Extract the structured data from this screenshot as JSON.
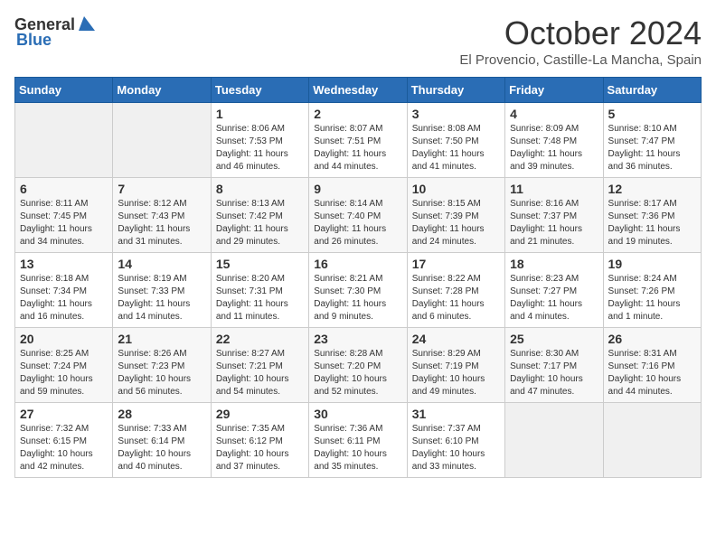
{
  "header": {
    "logo_general": "General",
    "logo_blue": "Blue",
    "month_title": "October 2024",
    "location": "El Provencio, Castille-La Mancha, Spain"
  },
  "weekdays": [
    "Sunday",
    "Monday",
    "Tuesday",
    "Wednesday",
    "Thursday",
    "Friday",
    "Saturday"
  ],
  "weeks": [
    [
      {
        "day": "",
        "empty": true
      },
      {
        "day": "",
        "empty": true
      },
      {
        "day": "1",
        "sunrise": "Sunrise: 8:06 AM",
        "sunset": "Sunset: 7:53 PM",
        "daylight": "Daylight: 11 hours and 46 minutes."
      },
      {
        "day": "2",
        "sunrise": "Sunrise: 8:07 AM",
        "sunset": "Sunset: 7:51 PM",
        "daylight": "Daylight: 11 hours and 44 minutes."
      },
      {
        "day": "3",
        "sunrise": "Sunrise: 8:08 AM",
        "sunset": "Sunset: 7:50 PM",
        "daylight": "Daylight: 11 hours and 41 minutes."
      },
      {
        "day": "4",
        "sunrise": "Sunrise: 8:09 AM",
        "sunset": "Sunset: 7:48 PM",
        "daylight": "Daylight: 11 hours and 39 minutes."
      },
      {
        "day": "5",
        "sunrise": "Sunrise: 8:10 AM",
        "sunset": "Sunset: 7:47 PM",
        "daylight": "Daylight: 11 hours and 36 minutes."
      }
    ],
    [
      {
        "day": "6",
        "sunrise": "Sunrise: 8:11 AM",
        "sunset": "Sunset: 7:45 PM",
        "daylight": "Daylight: 11 hours and 34 minutes."
      },
      {
        "day": "7",
        "sunrise": "Sunrise: 8:12 AM",
        "sunset": "Sunset: 7:43 PM",
        "daylight": "Daylight: 11 hours and 31 minutes."
      },
      {
        "day": "8",
        "sunrise": "Sunrise: 8:13 AM",
        "sunset": "Sunset: 7:42 PM",
        "daylight": "Daylight: 11 hours and 29 minutes."
      },
      {
        "day": "9",
        "sunrise": "Sunrise: 8:14 AM",
        "sunset": "Sunset: 7:40 PM",
        "daylight": "Daylight: 11 hours and 26 minutes."
      },
      {
        "day": "10",
        "sunrise": "Sunrise: 8:15 AM",
        "sunset": "Sunset: 7:39 PM",
        "daylight": "Daylight: 11 hours and 24 minutes."
      },
      {
        "day": "11",
        "sunrise": "Sunrise: 8:16 AM",
        "sunset": "Sunset: 7:37 PM",
        "daylight": "Daylight: 11 hours and 21 minutes."
      },
      {
        "day": "12",
        "sunrise": "Sunrise: 8:17 AM",
        "sunset": "Sunset: 7:36 PM",
        "daylight": "Daylight: 11 hours and 19 minutes."
      }
    ],
    [
      {
        "day": "13",
        "sunrise": "Sunrise: 8:18 AM",
        "sunset": "Sunset: 7:34 PM",
        "daylight": "Daylight: 11 hours and 16 minutes."
      },
      {
        "day": "14",
        "sunrise": "Sunrise: 8:19 AM",
        "sunset": "Sunset: 7:33 PM",
        "daylight": "Daylight: 11 hours and 14 minutes."
      },
      {
        "day": "15",
        "sunrise": "Sunrise: 8:20 AM",
        "sunset": "Sunset: 7:31 PM",
        "daylight": "Daylight: 11 hours and 11 minutes."
      },
      {
        "day": "16",
        "sunrise": "Sunrise: 8:21 AM",
        "sunset": "Sunset: 7:30 PM",
        "daylight": "Daylight: 11 hours and 9 minutes."
      },
      {
        "day": "17",
        "sunrise": "Sunrise: 8:22 AM",
        "sunset": "Sunset: 7:28 PM",
        "daylight": "Daylight: 11 hours and 6 minutes."
      },
      {
        "day": "18",
        "sunrise": "Sunrise: 8:23 AM",
        "sunset": "Sunset: 7:27 PM",
        "daylight": "Daylight: 11 hours and 4 minutes."
      },
      {
        "day": "19",
        "sunrise": "Sunrise: 8:24 AM",
        "sunset": "Sunset: 7:26 PM",
        "daylight": "Daylight: 11 hours and 1 minute."
      }
    ],
    [
      {
        "day": "20",
        "sunrise": "Sunrise: 8:25 AM",
        "sunset": "Sunset: 7:24 PM",
        "daylight": "Daylight: 10 hours and 59 minutes."
      },
      {
        "day": "21",
        "sunrise": "Sunrise: 8:26 AM",
        "sunset": "Sunset: 7:23 PM",
        "daylight": "Daylight: 10 hours and 56 minutes."
      },
      {
        "day": "22",
        "sunrise": "Sunrise: 8:27 AM",
        "sunset": "Sunset: 7:21 PM",
        "daylight": "Daylight: 10 hours and 54 minutes."
      },
      {
        "day": "23",
        "sunrise": "Sunrise: 8:28 AM",
        "sunset": "Sunset: 7:20 PM",
        "daylight": "Daylight: 10 hours and 52 minutes."
      },
      {
        "day": "24",
        "sunrise": "Sunrise: 8:29 AM",
        "sunset": "Sunset: 7:19 PM",
        "daylight": "Daylight: 10 hours and 49 minutes."
      },
      {
        "day": "25",
        "sunrise": "Sunrise: 8:30 AM",
        "sunset": "Sunset: 7:17 PM",
        "daylight": "Daylight: 10 hours and 47 minutes."
      },
      {
        "day": "26",
        "sunrise": "Sunrise: 8:31 AM",
        "sunset": "Sunset: 7:16 PM",
        "daylight": "Daylight: 10 hours and 44 minutes."
      }
    ],
    [
      {
        "day": "27",
        "sunrise": "Sunrise: 7:32 AM",
        "sunset": "Sunset: 6:15 PM",
        "daylight": "Daylight: 10 hours and 42 minutes."
      },
      {
        "day": "28",
        "sunrise": "Sunrise: 7:33 AM",
        "sunset": "Sunset: 6:14 PM",
        "daylight": "Daylight: 10 hours and 40 minutes."
      },
      {
        "day": "29",
        "sunrise": "Sunrise: 7:35 AM",
        "sunset": "Sunset: 6:12 PM",
        "daylight": "Daylight: 10 hours and 37 minutes."
      },
      {
        "day": "30",
        "sunrise": "Sunrise: 7:36 AM",
        "sunset": "Sunset: 6:11 PM",
        "daylight": "Daylight: 10 hours and 35 minutes."
      },
      {
        "day": "31",
        "sunrise": "Sunrise: 7:37 AM",
        "sunset": "Sunset: 6:10 PM",
        "daylight": "Daylight: 10 hours and 33 minutes."
      },
      {
        "day": "",
        "empty": true
      },
      {
        "day": "",
        "empty": true
      }
    ]
  ]
}
